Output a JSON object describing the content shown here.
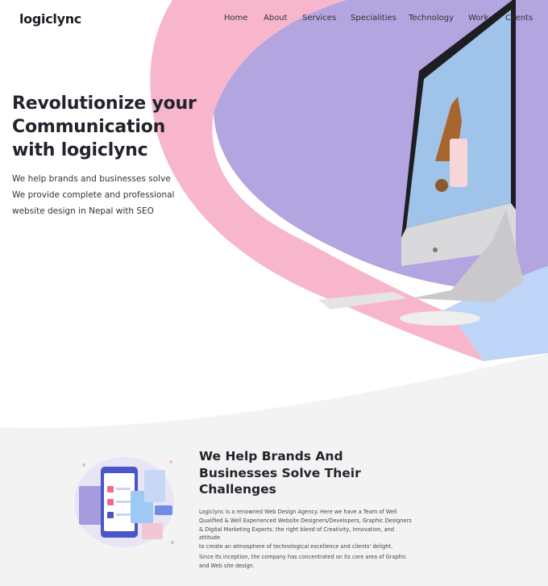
{
  "brand": {
    "logo_text": "logiclync",
    "accent": "#e8344a"
  },
  "nav": {
    "items": [
      "Home",
      "About",
      "Services",
      "Specialities",
      "Technology",
      "Work",
      "Clients"
    ]
  },
  "hero": {
    "title_lines": [
      "Revolutionize your",
      "Communication",
      "with logiclync"
    ],
    "sub_lines": [
      "We help brands and businesses solve",
      "We provide complete and professional",
      "website design in Nepal with SEO"
    ]
  },
  "colors": {
    "pink": "#f7b7cd",
    "lavender": "#b1a3df",
    "blue": "#bcd2f6",
    "section_bg": "#f3f3f3"
  },
  "section2": {
    "title_lines": [
      "We Help Brands And",
      "Businesses Solve Their",
      "Challenges"
    ],
    "paragraph1_lines": [
      "Logiclync is a renowned Web Design Agency. Here we have a Team of Well",
      "Qualified & Well Experienced Website Designers/Developers, Graphic Designers",
      "& Digital Marketing Experts. the right blend of Creativity, Innovation, and attitude",
      "to create an atmosphere of technological excellence and clients' delight."
    ],
    "paragraph2_lines": [
      "Since its inception, the company has concentrated on its core area of Graphic",
      "and Web site design."
    ]
  }
}
